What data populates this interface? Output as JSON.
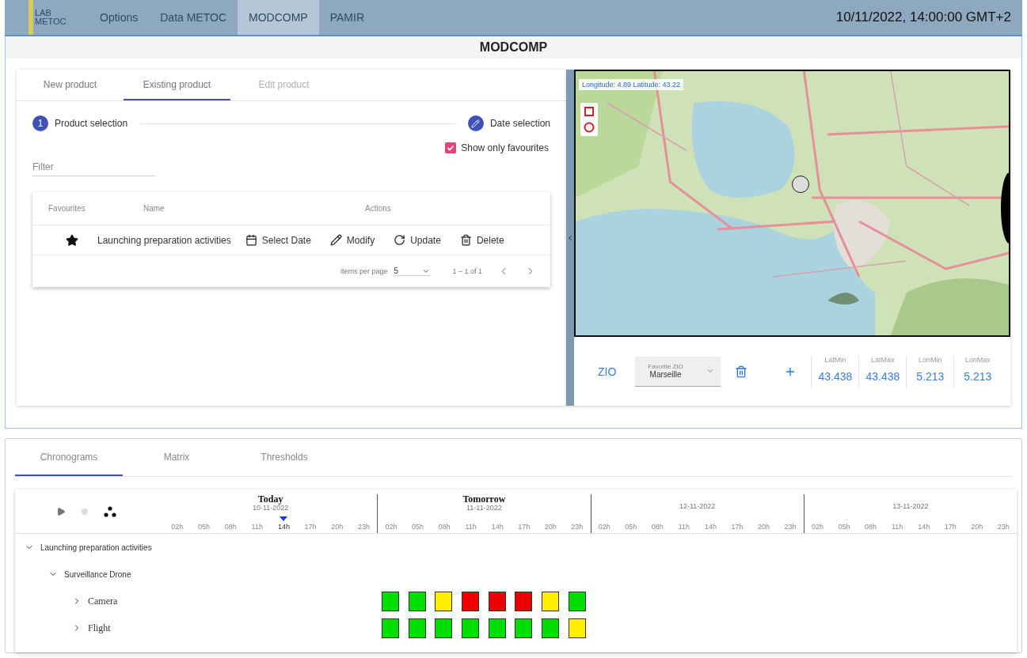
{
  "nav": {
    "logo_top": "LAB",
    "logo_bottom": "METOC",
    "items": [
      {
        "label": "Options",
        "selected": false
      },
      {
        "label": "Data METOC",
        "selected": false
      },
      {
        "label": "MODCOMP",
        "selected": true
      },
      {
        "label": "PAMIR",
        "selected": false
      }
    ],
    "datetime": "10/11/2022, 14:00:00 GMT+2"
  },
  "title": "MODCOMP",
  "product_tabs": [
    {
      "label": "New product",
      "selected": false,
      "disabled": false
    },
    {
      "label": "Existing product",
      "selected": true,
      "disabled": false
    },
    {
      "label": "Edit product",
      "selected": false,
      "disabled": true
    }
  ],
  "stepper": [
    {
      "kind": "number",
      "number": "1",
      "label": "Product selection"
    },
    {
      "kind": "edit",
      "label": "Date selection"
    }
  ],
  "favourites_filter": {
    "label": "Show only favourites",
    "checked": true
  },
  "filter": {
    "placeholder": "Filter"
  },
  "table": {
    "columns": [
      "Favourites",
      "Name",
      "Actions"
    ],
    "rows": [
      {
        "favourite": true,
        "name": "Launching preparation activities",
        "actions": [
          {
            "kind": "calendar",
            "label": "Select Date"
          },
          {
            "kind": "edit",
            "label": "Modify"
          },
          {
            "kind": "update",
            "label": "Update"
          },
          {
            "kind": "delete",
            "label": "Delete"
          }
        ]
      }
    ],
    "paginator": {
      "label": "items per page",
      "value": "5",
      "range": "1 – 1 of 1"
    }
  },
  "map": {
    "coordinates": "Longitude: 4.89 Latitude: 43.22",
    "zio": {
      "label": "ZIO",
      "select_label": "Favorite ZIO",
      "select_value": "Marseille",
      "bounds": [
        {
          "label": "LatMin",
          "value": "43.438"
        },
        {
          "label": "LatMax",
          "value": "43.438"
        },
        {
          "label": "LonMin",
          "value": "5.213"
        },
        {
          "label": "LonMax",
          "value": "5.213"
        }
      ]
    }
  },
  "bottom_tabs": [
    {
      "label": "Chronograms",
      "selected": true
    },
    {
      "label": "Matrix",
      "selected": false
    },
    {
      "label": "Thresholds",
      "selected": false
    }
  ],
  "timeline": {
    "days": [
      {
        "title": "Today",
        "date": "10-11-2022",
        "hours": [
          {
            "label": "02h",
            "current": false
          },
          {
            "label": "05h",
            "current": false
          },
          {
            "label": "08h",
            "current": false
          },
          {
            "label": "11h",
            "current": false
          },
          {
            "label": "14h",
            "current": true
          },
          {
            "label": "17h",
            "current": false
          },
          {
            "label": "20h",
            "current": false
          },
          {
            "label": "23h",
            "current": false
          }
        ]
      },
      {
        "title": "Tomorrow",
        "date": "11-11-2022",
        "hours": [
          {
            "label": "02h",
            "current": false
          },
          {
            "label": "05h",
            "current": false
          },
          {
            "label": "08h",
            "current": false
          },
          {
            "label": "11h",
            "current": false
          },
          {
            "label": "14h",
            "current": false
          },
          {
            "label": "17h",
            "current": false
          },
          {
            "label": "20h",
            "current": false
          },
          {
            "label": "23h",
            "current": false
          }
        ]
      },
      {
        "date": "12-11-2022",
        "hours": [
          {
            "label": "02h",
            "current": false
          },
          {
            "label": "05h",
            "current": false
          },
          {
            "label": "08h",
            "current": false
          },
          {
            "label": "11h",
            "current": false
          },
          {
            "label": "14h",
            "current": false
          },
          {
            "label": "17h",
            "current": false
          },
          {
            "label": "20h",
            "current": false
          },
          {
            "label": "23h",
            "current": false
          }
        ]
      },
      {
        "date": "13-11-2022",
        "hours": [
          {
            "label": "02h",
            "current": false
          },
          {
            "label": "05h",
            "current": false
          },
          {
            "label": "08h",
            "current": false
          },
          {
            "label": "11h",
            "current": false
          },
          {
            "label": "14h",
            "current": false
          },
          {
            "label": "17h",
            "current": false
          },
          {
            "label": "20h",
            "current": false
          },
          {
            "label": "23h",
            "current": false
          }
        ]
      }
    ],
    "tree": [
      {
        "label": "Launching preparation activities",
        "expanded": true,
        "children": [
          {
            "label": "Surveillance Drone",
            "expanded": true,
            "children": [
              {
                "label": "Camera",
                "expanded": false,
                "blocks": [
                  {
                    "color": "#00dd00"
                  },
                  {
                    "color": "#00dd00"
                  },
                  {
                    "color": "#ffee00"
                  },
                  {
                    "color": "#ee0000"
                  },
                  {
                    "color": "#ee0000"
                  },
                  {
                    "color": "#ee0000"
                  },
                  {
                    "color": "#ffee00"
                  },
                  {
                    "color": "#00dd00"
                  }
                ]
              },
              {
                "label": "Flight",
                "expanded": false,
                "blocks": [
                  {
                    "color": "#00dd00"
                  },
                  {
                    "color": "#00dd00"
                  },
                  {
                    "color": "#00dd00"
                  },
                  {
                    "color": "#00dd00"
                  },
                  {
                    "color": "#00dd00"
                  },
                  {
                    "color": "#00dd00"
                  },
                  {
                    "color": "#00dd00"
                  },
                  {
                    "color": "#ffee00"
                  }
                ]
              }
            ]
          }
        ]
      }
    ]
  }
}
